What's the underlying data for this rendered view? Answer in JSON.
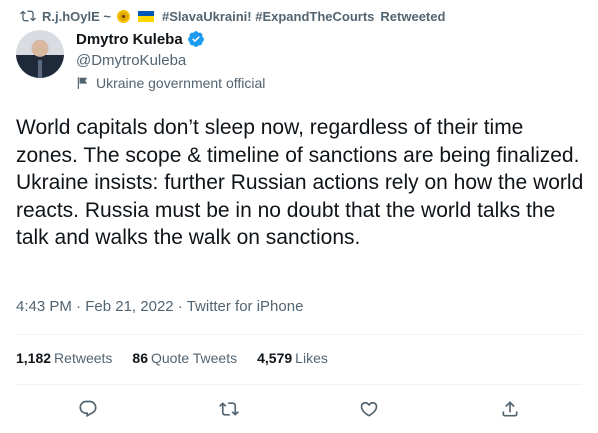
{
  "retweet_header": {
    "retweeter_name": "R.j.hOylE ~",
    "hashtags": "#SlavaUkraini! #ExpandTheCourts",
    "action": "Retweeted"
  },
  "author": {
    "name": "Dmytro Kuleba",
    "handle": "@DmytroKuleba",
    "affiliation": "Ukraine government official"
  },
  "tweet": {
    "text": "World capitals don’t sleep now, regardless of their time zones. The scope & timeline of sanctions are being finalized. Ukraine insists: further Russian actions rely on how the world reacts. Russia must be in no doubt that the world talks the talk and walks the walk on sanctions."
  },
  "meta": {
    "time": "4:43 PM",
    "date": "Feb 21, 2022",
    "source": "Twitter for iPhone",
    "separator": "·"
  },
  "stats": {
    "retweets_count": "1,182",
    "retweets_label": "Retweets",
    "quotes_count": "86",
    "quotes_label": "Quote Tweets",
    "likes_count": "4,579",
    "likes_label": "Likes"
  },
  "icons": {
    "retweet_header": "retweet-icon",
    "verified": "verified-badge-icon",
    "affiliation": "flag-icon",
    "reply": "reply-icon",
    "retweet": "retweet-icon",
    "like": "heart-icon",
    "share": "share-icon"
  },
  "colors": {
    "text_primary": "#0f1419",
    "text_secondary": "#536471",
    "verified": "#1d9bf0",
    "divider": "#eff3f4"
  }
}
